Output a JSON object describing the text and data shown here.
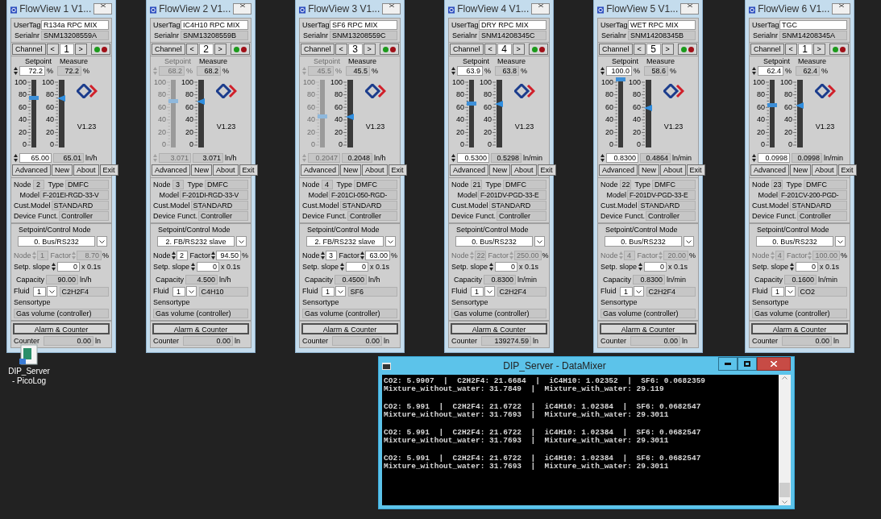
{
  "panels": [
    {
      "title": "FlowView 1 V1...",
      "labels": {
        "usertag": "UserTag",
        "serial": "Serialnr",
        "channel": "Channel",
        "prev": "<",
        "next": ">",
        "setpoint": "Setpoint",
        "measure": "Measure",
        "pct1": "%",
        "pct2": "%",
        "version": "V1.23",
        "advanced": "Advanced",
        "new": "New",
        "about": "About",
        "exit": "Exit",
        "node": "Node",
        "type": "Type",
        "model": "Model",
        "cust": "Cust.Model",
        "device": "Device Funct.",
        "mode": "Setpoint/Control Mode",
        "slave_node": "Node",
        "factor": "Factor",
        "pct3": "%",
        "slope": "Setp. slope",
        "slope_unit": "x 0.1s",
        "capacity": "Capacity",
        "fluid": "Fluid",
        "sensortype": "Sensortype",
        "alarm": "Alarm & Counter",
        "counter": "Counter"
      },
      "setpoint_scale": [
        "100",
        "80",
        "60",
        "40",
        "20",
        "0"
      ],
      "measure_scale": [
        "100",
        "80",
        "60",
        "40",
        "20",
        "0"
      ],
      "usertag": "R134a RPC MIX",
      "serial": "SNM13208559A",
      "channel": "1",
      "setpoint": {
        "value": "72.2",
        "enabled": true,
        "level": 0.722
      },
      "measure": {
        "value": "72.2",
        "level": 0.722
      },
      "flow_setpoint": "65.00",
      "flow_measure": "65.01",
      "flow_unit": "ln/h",
      "node": "2",
      "type": "DMFC",
      "model": "F-201EI-RGD-33-V",
      "cust_model": "STANDARD",
      "device_function": "Controller",
      "control_mode": "0. Bus/RS232",
      "slave": {
        "enabled": false,
        "node": "1",
        "factor": "8.70"
      },
      "slope": "0",
      "capacity": "90.00",
      "capacity_unit": "ln/h",
      "fluid_number": "1",
      "fluid_name": "C2H2F4",
      "sensor": "Gas volume (controller)",
      "counter": "0.00",
      "counter_unit": "ln"
    },
    {
      "title": "FlowView 2 V1...",
      "labels": {
        "usertag": "UserTag",
        "serial": "Serialnr",
        "channel": "Channel",
        "prev": "<",
        "next": ">",
        "setpoint": "Setpoint",
        "measure": "Measure",
        "pct1": "%",
        "pct2": "%",
        "version": "V1.23",
        "advanced": "Advanced",
        "new": "New",
        "about": "About",
        "exit": "Exit",
        "node": "Node",
        "type": "Type",
        "model": "Model",
        "cust": "Cust.Model",
        "device": "Device Funct.",
        "mode": "Setpoint/Control Mode",
        "slave_node": "Node",
        "factor": "Factor",
        "pct3": "%",
        "slope": "Setp. slope",
        "slope_unit": "x 0.1s",
        "capacity": "Capacity",
        "fluid": "Fluid",
        "sensortype": "Sensortype",
        "alarm": "Alarm & Counter",
        "counter": "Counter"
      },
      "setpoint_scale": [
        "100",
        "80",
        "60",
        "40",
        "20",
        "0"
      ],
      "measure_scale": [
        "100",
        "80",
        "60",
        "40",
        "20",
        "0"
      ],
      "usertag": "IC4H10 RPC MIX",
      "serial": "SNM13208559B",
      "channel": "2",
      "setpoint": {
        "value": "68.2",
        "enabled": false,
        "level": 0.682
      },
      "measure": {
        "value": "68.2",
        "level": 0.682
      },
      "flow_setpoint": "3.071",
      "flow_measure": "3.071",
      "flow_unit": "ln/h",
      "node": "3",
      "type": "DMFC",
      "model": "F-201DI-RGD-33-V",
      "cust_model": "STANDARD",
      "device_function": "Controller",
      "control_mode": "2. FB/RS232 slave",
      "slave": {
        "enabled": true,
        "node": "2",
        "factor": "94.50"
      },
      "slope": "0",
      "capacity": "4.500",
      "capacity_unit": "ln/h",
      "fluid_number": "1",
      "fluid_name": "C4H10",
      "sensor": "Gas volume (controller)",
      "counter": "0.00",
      "counter_unit": "ln"
    },
    {
      "title": "FlowView 3 V1...",
      "labels": {
        "usertag": "UserTag",
        "serial": "Serialnr",
        "channel": "Channel",
        "prev": "<",
        "next": ">",
        "setpoint": "Setpoint",
        "measure": "Measure",
        "pct1": "%",
        "pct2": "%",
        "version": "V1.23",
        "advanced": "Advanced",
        "new": "New",
        "about": "About",
        "exit": "Exit",
        "node": "Node",
        "type": "Type",
        "model": "Model",
        "cust": "Cust.Model",
        "device": "Device Funct.",
        "mode": "Setpoint/Control Mode",
        "slave_node": "Node",
        "factor": "Factor",
        "pct3": "%",
        "slope": "Setp. slope",
        "slope_unit": "x 0.1s",
        "capacity": "Capacity",
        "fluid": "Fluid",
        "sensortype": "Sensortype",
        "alarm": "Alarm & Counter",
        "counter": "Counter"
      },
      "setpoint_scale": [
        "100",
        "80",
        "60",
        "40",
        "20",
        "0"
      ],
      "measure_scale": [
        "100",
        "80",
        "60",
        "40",
        "20",
        "0"
      ],
      "usertag": "SF6 RPC MIX",
      "serial": "SNM13208559C",
      "channel": "3",
      "setpoint": {
        "value": "45.5",
        "enabled": false,
        "level": 0.455
      },
      "measure": {
        "value": "45.5",
        "level": 0.455
      },
      "flow_setpoint": "0.2047",
      "flow_measure": "0.2048",
      "flow_unit": "ln/h",
      "node": "4",
      "type": "DMFC",
      "model": "F-201CI-050-RGD-",
      "cust_model": "STANDARD",
      "device_function": "Controller",
      "control_mode": "2. FB/RS232 slave",
      "slave": {
        "enabled": true,
        "node": "3",
        "factor": "63.00"
      },
      "slope": "0",
      "capacity": "0.4500",
      "capacity_unit": "ln/h",
      "fluid_number": "1",
      "fluid_name": "SF6",
      "sensor": "Gas volume (controller)",
      "counter": "0.00",
      "counter_unit": "ln"
    },
    {
      "title": "FlowView 4 V1...",
      "labels": {
        "usertag": "UserTag",
        "serial": "Serialnr",
        "channel": "Channel",
        "prev": "<",
        "next": ">",
        "setpoint": "Setpoint",
        "measure": "Measure",
        "pct1": "%",
        "pct2": "%",
        "version": "V1.23",
        "advanced": "Advanced",
        "new": "New",
        "about": "About",
        "exit": "Exit",
        "node": "Node",
        "type": "Type",
        "model": "Model",
        "cust": "Cust.Model",
        "device": "Device Funct.",
        "mode": "Setpoint/Control Mode",
        "slave_node": "Node",
        "factor": "Factor",
        "pct3": "%",
        "slope": "Setp. slope",
        "slope_unit": "x 0.1s",
        "capacity": "Capacity",
        "fluid": "Fluid",
        "sensortype": "Sensortype",
        "alarm": "Alarm & Counter",
        "counter": "Counter"
      },
      "setpoint_scale": [
        "100",
        "80",
        "60",
        "40",
        "20",
        "0"
      ],
      "measure_scale": [
        "100",
        "80",
        "60",
        "40",
        "20",
        "0"
      ],
      "usertag": "DRY RPC MIX",
      "serial": "SNM14208345C",
      "channel": "4",
      "setpoint": {
        "value": "63.9",
        "enabled": true,
        "level": 0.639
      },
      "measure": {
        "value": "63.8",
        "level": 0.638
      },
      "flow_setpoint": "0.5300",
      "flow_measure": "0.5298",
      "flow_unit": "ln/min",
      "node": "21",
      "type": "DMFC",
      "model": "F-201DV-PGD-33-E",
      "cust_model": "STANDARD",
      "device_function": "Controller",
      "control_mode": "0. Bus/RS232",
      "slave": {
        "enabled": false,
        "node": "22",
        "factor": "250.00"
      },
      "slope": "0",
      "capacity": "0.8300",
      "capacity_unit": "ln/min",
      "fluid_number": "1",
      "fluid_name": "C2H2F4",
      "sensor": "Gas volume (controller)",
      "counter": "139274.59",
      "counter_unit": "ln"
    },
    {
      "title": "FlowView 5 V1...",
      "labels": {
        "usertag": "UserTag",
        "serial": "Serialnr",
        "channel": "Channel",
        "prev": "<",
        "next": ">",
        "setpoint": "Setpoint",
        "measure": "Measure",
        "pct1": "%",
        "pct2": "%",
        "version": "V1.23",
        "advanced": "Advanced",
        "new": "New",
        "about": "About",
        "exit": "Exit",
        "node": "Node",
        "type": "Type",
        "model": "Model",
        "cust": "Cust.Model",
        "device": "Device Funct.",
        "mode": "Setpoint/Control Mode",
        "slave_node": "Node",
        "factor": "Factor",
        "pct3": "%",
        "slope": "Setp. slope",
        "slope_unit": "x 0.1s",
        "capacity": "Capacity",
        "fluid": "Fluid",
        "sensortype": "Sensortype",
        "alarm": "Alarm & Counter",
        "counter": "Counter"
      },
      "setpoint_scale": [
        "100",
        "80",
        "60",
        "40",
        "20",
        "0"
      ],
      "measure_scale": [
        "100",
        "80",
        "60",
        "40",
        "20",
        "0"
      ],
      "usertag": "WET RPC MIX",
      "serial": "SNM14208345B",
      "channel": "5",
      "setpoint": {
        "value": "100.0",
        "enabled": true,
        "level": 1.0
      },
      "measure": {
        "value": "58.6",
        "level": 0.586
      },
      "flow_setpoint": "0.8300",
      "flow_measure": "0.4864",
      "flow_unit": "ln/min",
      "node": "22",
      "type": "DMFC",
      "model": "F-201DV-PGD-33-E",
      "cust_model": "STANDARD",
      "device_function": "Controller",
      "control_mode": "0. Bus/RS232",
      "slave": {
        "enabled": false,
        "node": "4",
        "factor": "20.00"
      },
      "slope": "0",
      "capacity": "0.8300",
      "capacity_unit": "ln/min",
      "fluid_number": "1",
      "fluid_name": "C2H2F4",
      "sensor": "Gas volume (controller)",
      "counter": "0.00",
      "counter_unit": "ln"
    },
    {
      "title": "FlowView 6 V1...",
      "labels": {
        "usertag": "UserTag",
        "serial": "Serialnr",
        "channel": "Channel",
        "prev": "<",
        "next": ">",
        "setpoint": "Setpoint",
        "measure": "Measure",
        "pct1": "%",
        "pct2": "%",
        "version": "V1.23",
        "advanced": "Advanced",
        "new": "New",
        "about": "About",
        "exit": "Exit",
        "node": "Node",
        "type": "Type",
        "model": "Model",
        "cust": "Cust.Model",
        "device": "Device Funct.",
        "mode": "Setpoint/Control Mode",
        "slave_node": "Node",
        "factor": "Factor",
        "pct3": "%",
        "slope": "Setp. slope",
        "slope_unit": "x 0.1s",
        "capacity": "Capacity",
        "fluid": "Fluid",
        "sensortype": "Sensortype",
        "alarm": "Alarm & Counter",
        "counter": "Counter"
      },
      "setpoint_scale": [
        "100",
        "80",
        "60",
        "40",
        "20",
        "0"
      ],
      "measure_scale": [
        "100",
        "80",
        "60",
        "40",
        "20",
        "0"
      ],
      "usertag": "TGC",
      "serial": "SNM14208345A",
      "channel": "1",
      "setpoint": {
        "value": "62.4",
        "enabled": true,
        "level": 0.624
      },
      "measure": {
        "value": "62.4",
        "level": 0.624
      },
      "flow_setpoint": "0.0998",
      "flow_measure": "0.0998",
      "flow_unit": "ln/min",
      "node": "23",
      "type": "DMFC",
      "model": "F-201CV-200-PGD-",
      "cust_model": "STANDARD",
      "device_function": "Controller",
      "control_mode": "0. Bus/RS232",
      "slave": {
        "enabled": false,
        "node": "4",
        "factor": "100.00"
      },
      "slope": "0",
      "capacity": "0.1600",
      "capacity_unit": "ln/min",
      "fluid_number": "1",
      "fluid_name": "CO2",
      "sensor": "Gas volume (controller)",
      "counter": "0.00",
      "counter_unit": "ln"
    }
  ],
  "desktop_icon": {
    "label": "DIP_Server - PicoLog"
  },
  "console": {
    "title": "DIP_Server - DataMixer",
    "blocks": [
      [
        "CO2: 5.9907  |  C2H2F4: 21.6684  |  iC4H10: 1.02352  |  SF6: 0.0682359",
        "Mixture_without_water: 31.7849  |  Mixture_with_water: 29.119"
      ],
      [
        "CO2: 5.991  |  C2H2F4: 21.6722  |  iC4H10: 1.02384  |  SF6: 0.0682547",
        "Mixture_without_water: 31.7693  |  Mixture_with_water: 29.3011"
      ],
      [
        "CO2: 5.991  |  C2H2F4: 21.6722  |  iC4H10: 1.02384  |  SF6: 0.0682547",
        "Mixture_without_water: 31.7693  |  Mixture_with_water: 29.3011"
      ],
      [
        "CO2: 5.991  |  C2H2F4: 21.6722  |  iC4H10: 1.02384  |  SF6: 0.0682547",
        "Mixture_without_water: 31.7693  |  Mixture_with_water: 29.3011"
      ]
    ]
  }
}
